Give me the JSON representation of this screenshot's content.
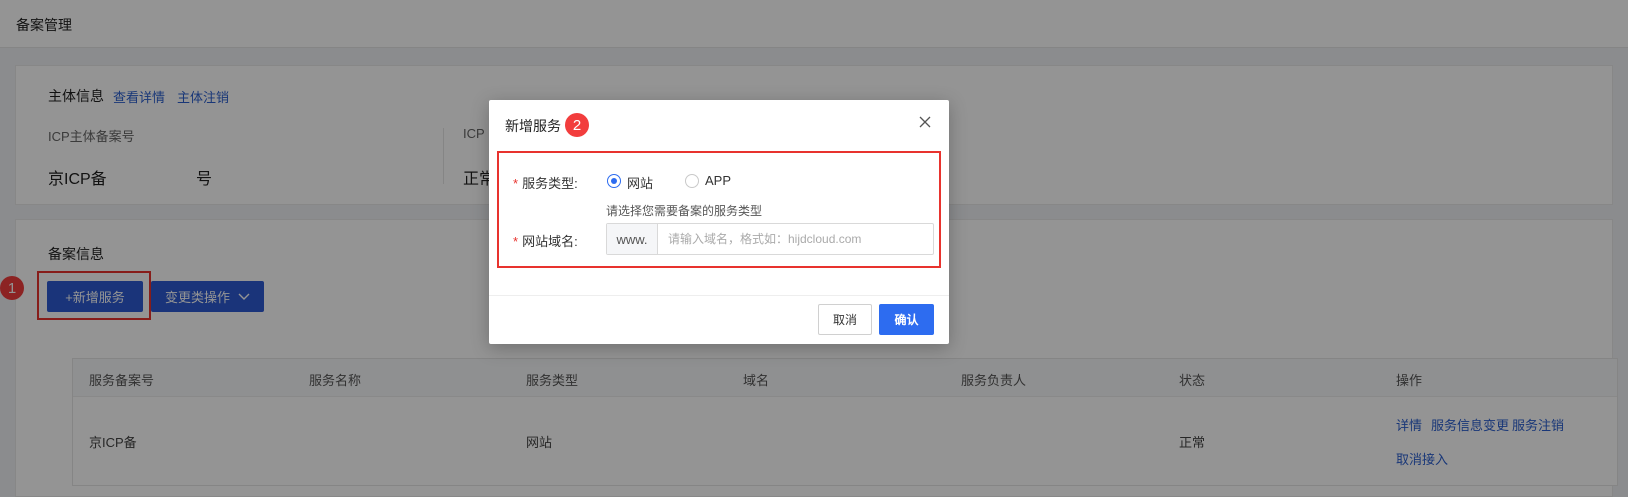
{
  "header": {
    "title": "备案管理"
  },
  "subject": {
    "title": "主体信息",
    "view_link": "查看详情",
    "cancel_link": "主体注销",
    "icp_label": "ICP主体备案号",
    "icp_value_prefix": "京ICP备",
    "icp_value_suffix": "号",
    "status_label_partial": "ICP",
    "status_value_partial": "正常"
  },
  "record": {
    "title": "备案信息",
    "add_button": "+新增服务",
    "change_button": "变更类操作",
    "badge_1": "1"
  },
  "table": {
    "headers": [
      "服务备案号",
      "服务名称",
      "服务类型",
      "域名",
      "服务负责人",
      "状态",
      "操作"
    ],
    "row": {
      "record_no": "京ICP备",
      "name": "",
      "type": "网站",
      "domain": "",
      "owner": "",
      "status": "正常",
      "actions": [
        "详情",
        "服务信息变更",
        "服务注销",
        "取消接入"
      ]
    }
  },
  "modal": {
    "title": "新增服务",
    "badge_2": "2",
    "service_type_label": "服务类型:",
    "options": [
      {
        "label": "网站",
        "selected": true
      },
      {
        "label": "APP",
        "selected": false
      }
    ],
    "hint": "请选择您需要备案的服务类型",
    "domain_label": "网站域名:",
    "domain_prefix": "www.",
    "domain_placeholder": "请输入域名，格式如：hijdcloud.com",
    "cancel": "取消",
    "confirm": "确认"
  },
  "colors": {
    "accent": "#2d5bd2",
    "highlight": "#e8332e"
  }
}
